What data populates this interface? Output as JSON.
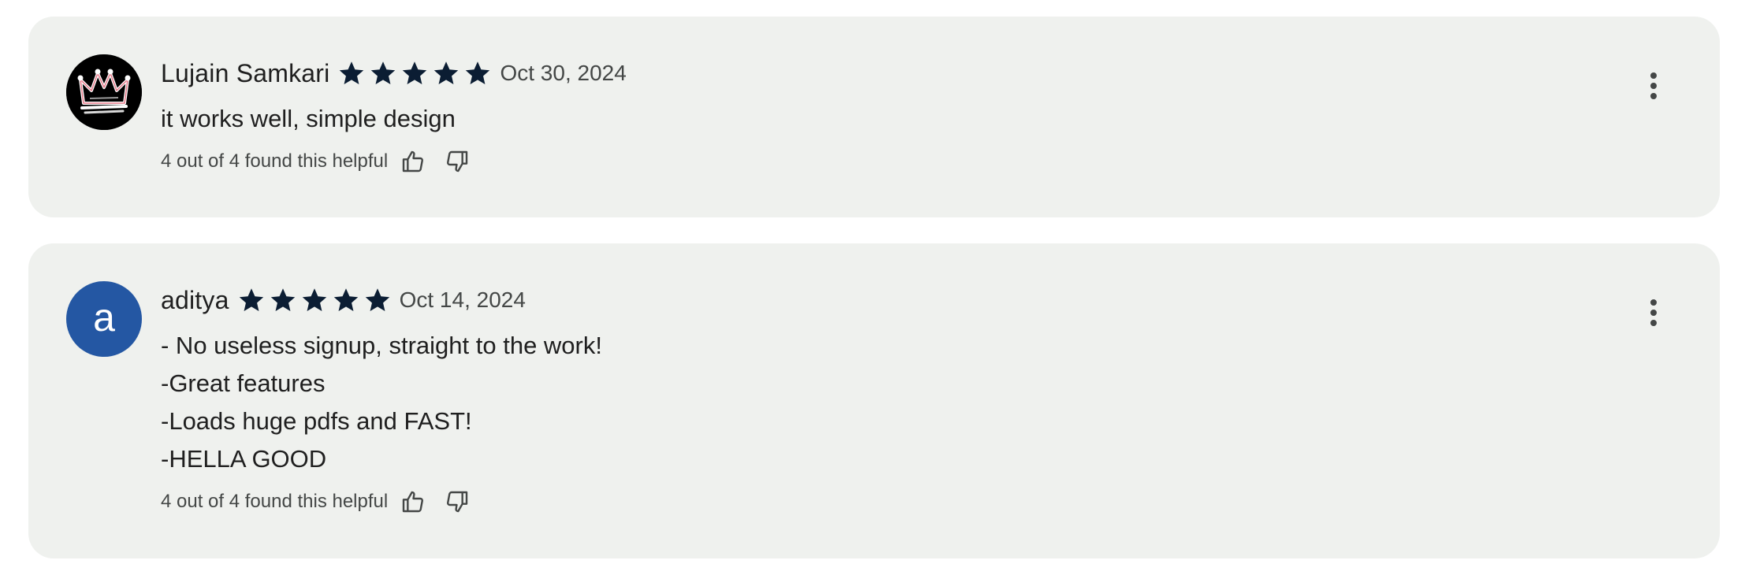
{
  "colors": {
    "card_background": "#eff1ee",
    "star_fill": "#0b1d33",
    "avatar_letter_bg": "#2457a3",
    "secondary_text": "#444746"
  },
  "reviews": [
    {
      "reviewer_name": "Lujain Samkari",
      "avatar": {
        "type": "image",
        "icon": "crown-icon"
      },
      "rating": 5,
      "date": "Oct 30, 2024",
      "text_lines": [
        "it works well, simple design"
      ],
      "helpful_text": "4 out of 4 found this helpful"
    },
    {
      "reviewer_name": "aditya",
      "avatar": {
        "type": "letter",
        "letter": "a"
      },
      "rating": 5,
      "date": "Oct 14, 2024",
      "text_lines": [
        "- No useless signup, straight to the work!",
        "-Great features",
        "-Loads huge pdfs and FAST!",
        "-HELLA GOOD"
      ],
      "helpful_text": "4 out of 4 found this helpful"
    }
  ]
}
